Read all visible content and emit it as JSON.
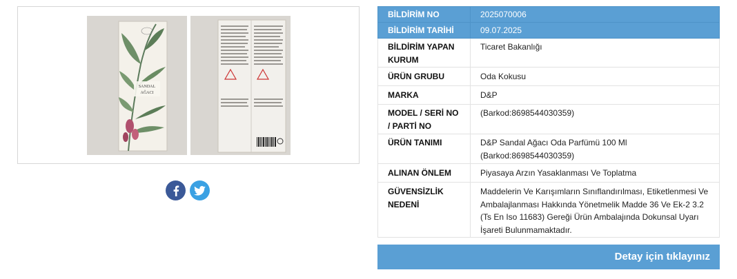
{
  "table": {
    "rows": [
      {
        "label": "BİLDİRİM NO",
        "value": "2025070006"
      },
      {
        "label": "BİLDİRİM TARİHİ",
        "value": "09.07.2025"
      },
      {
        "label": "BİLDİRİM YAPAN KURUM",
        "value": "Ticaret Bakanlığı"
      },
      {
        "label": "ÜRÜN GRUBU",
        "value": "Oda Kokusu"
      },
      {
        "label": "MARKA",
        "value": "D&P"
      },
      {
        "label": "MODEL / SERİ NO / PARTİ NO",
        "value": "(Barkod:8698544030359)"
      },
      {
        "label": "ÜRÜN TANIMI",
        "value": "D&P Sandal Ağacı Oda Parfümü 100 Ml (Barkod:8698544030359)"
      },
      {
        "label": "ALINAN ÖNLEM",
        "value": "Piyasaya Arzın Yasaklanması Ve Toplatma"
      },
      {
        "label": "GÜVENSİZLİK NEDENİ",
        "value": "Maddelerin Ve Karışımların Sınıflandırılması, Etiketlenmesi Ve Ambalajlanması Hakkında Yönetmelik Madde 36 Ve Ek-2 3.2 (Ts En Iso 11683) Gereği Ürün Ambalajında Dokunsal Uyarı İşareti Bulunmamaktadır."
      }
    ]
  },
  "detail_button": "Detay için tıklayınız",
  "product_box": {
    "line1": "SANDAL",
    "line2": "AĞACI"
  },
  "social": {
    "icons": [
      "facebook-icon",
      "twitter-icon"
    ]
  },
  "colors": {
    "header_blue": "#5a9fd4",
    "facebook": "#3b5998",
    "twitter": "#3ba1e3"
  }
}
